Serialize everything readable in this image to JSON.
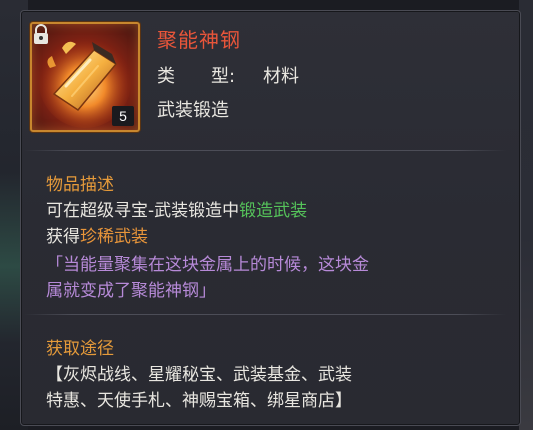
{
  "item": {
    "name": "聚能神钢",
    "type_label": "类　　型:",
    "type_value": "材料",
    "tag": "武装锻造",
    "stack_count": "5",
    "icon": "glowing-ingot-icon",
    "lock_icon": "lock-icon"
  },
  "description": {
    "title": "物品描述",
    "line1_prefix": "可在超级寻宝-武装锻造中",
    "line1_highlight": "锻造武装",
    "line2_prefix": "获得",
    "line2_highlight": "珍稀武装",
    "lore_line1": "「当能量聚集在这块金属上的时候，这块金",
    "lore_line2": "属就变成了聚能神钢」"
  },
  "source": {
    "title": "获取途径",
    "line1": "【灰烬战线、星耀秘宝、武装基金、武装",
    "line2": "特惠、天使手札、神赐宝箱、绑星商店】"
  },
  "colors": {
    "name": "#e8553a",
    "section_title": "#e59a3a",
    "highlight_green": "#55c35a",
    "highlight_orange": "#e8953a",
    "lore_purple": "#b78ad8",
    "text": "#e8e6e0",
    "panel_bg": "#2c2d35"
  }
}
